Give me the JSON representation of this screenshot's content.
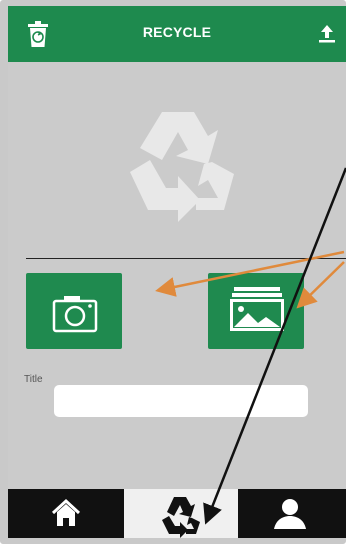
{
  "header": {
    "title": "RECYCLE",
    "left_icon": "trash-icon",
    "right_icon": "upload-icon"
  },
  "hero": {
    "icon": "recycle-logo-icon"
  },
  "actions": [
    {
      "name": "camera-button",
      "icon": "camera-icon"
    },
    {
      "name": "gallery-button",
      "icon": "gallery-icon"
    }
  ],
  "form": {
    "title_label": "Title",
    "title_value": ""
  },
  "bottom_nav": [
    {
      "name": "home",
      "icon": "home-icon",
      "active": false
    },
    {
      "name": "recycle",
      "icon": "recycle-icon",
      "active": true
    },
    {
      "name": "profile",
      "icon": "profile-icon",
      "active": false
    }
  ],
  "colors": {
    "brand": "#1e8a4e",
    "background": "#cbcbcb",
    "nav_background": "#111111",
    "annotation_arrow": "#e08a3c"
  }
}
